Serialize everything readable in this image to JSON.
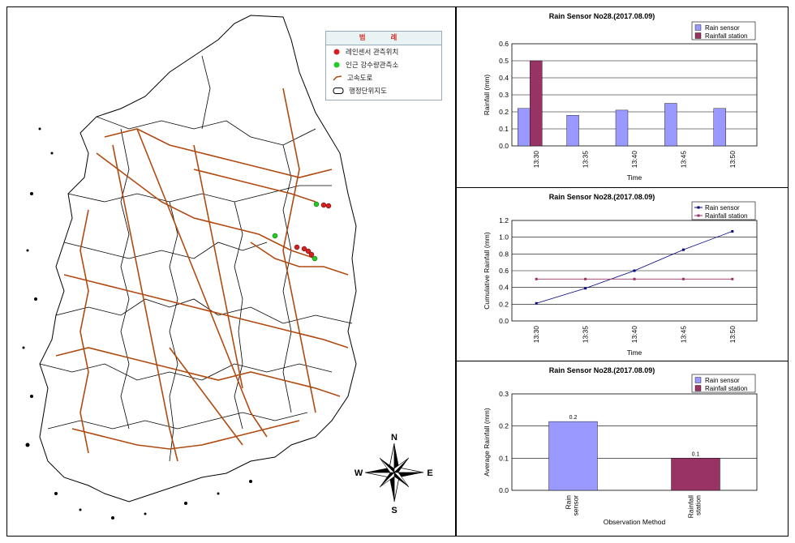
{
  "map": {
    "legend": {
      "title": "범 례",
      "items": [
        {
          "label": "레인센서 관측위치",
          "symbol": "red-dot",
          "color": "#d42020"
        },
        {
          "label": "인근 강수량관측소",
          "symbol": "green-dot",
          "color": "#22cc22"
        },
        {
          "label": "고속도로",
          "symbol": "orange-line",
          "color": "#b04a10"
        },
        {
          "label": "행정단위지도",
          "symbol": "outline-box",
          "color": "#000000"
        }
      ]
    },
    "compass": {
      "n": "N",
      "s": "S",
      "e": "E",
      "w": "W"
    }
  },
  "colors": {
    "rain_sensor": "#9999ff",
    "rainfall_station": "#993366",
    "plot_bg": "#c0c0c0",
    "line_sensor": "#000080",
    "line_station": "#993366"
  },
  "chart_data": [
    {
      "type": "bar",
      "title": "Rain Sensor No28.(2017.08.09)",
      "xlabel": "Time",
      "ylabel": "Rainfall (mm)",
      "ylim": [
        0,
        0.6
      ],
      "yticks": [
        "0.0",
        "0.1",
        "0.2",
        "0.3",
        "0.4",
        "0.5",
        "0.6"
      ],
      "categories": [
        "13:30",
        "13:35",
        "13:40",
        "13:45",
        "13:50"
      ],
      "series": [
        {
          "name": "Rain sensor",
          "values": [
            0.22,
            0.18,
            0.21,
            0.25,
            0.22
          ]
        },
        {
          "name": "Rainfall station",
          "values": [
            0.5,
            0,
            0,
            0,
            0
          ]
        }
      ],
      "legend": "top-right"
    },
    {
      "type": "line",
      "title": "Rain Sensor No28.(2017.08.09)",
      "xlabel": "Time",
      "ylabel": "Cumulative Rainfall (mm)",
      "ylim": [
        0,
        1.2
      ],
      "yticks": [
        "0.0",
        "0.2",
        "0.4",
        "0.6",
        "0.8",
        "1.0",
        "1.2"
      ],
      "categories": [
        "13:30",
        "13:35",
        "13:40",
        "13:45",
        "13:50"
      ],
      "series": [
        {
          "name": "Rain sensor",
          "values": [
            0.21,
            0.39,
            0.6,
            0.85,
            1.07
          ]
        },
        {
          "name": "Rainfall station",
          "values": [
            0.5,
            0.5,
            0.5,
            0.5,
            0.5
          ]
        }
      ],
      "legend": "top-right"
    },
    {
      "type": "bar",
      "title": "Rain Sensor No28.(2017.08.09)",
      "xlabel": "Observation Method",
      "ylabel": "Average Rainfall (mm)",
      "ylim": [
        0,
        0.3
      ],
      "yticks": [
        "0.0",
        "0.1",
        "0.2",
        "0.3"
      ],
      "categories": [
        "Rain sensor",
        "Rainfall station"
      ],
      "values": [
        0.214,
        0.1
      ],
      "data_labels": [
        "0.2",
        "0.1"
      ],
      "series_names": [
        "Rain sensor",
        "Rainfall station"
      ],
      "legend": "top-right"
    }
  ]
}
